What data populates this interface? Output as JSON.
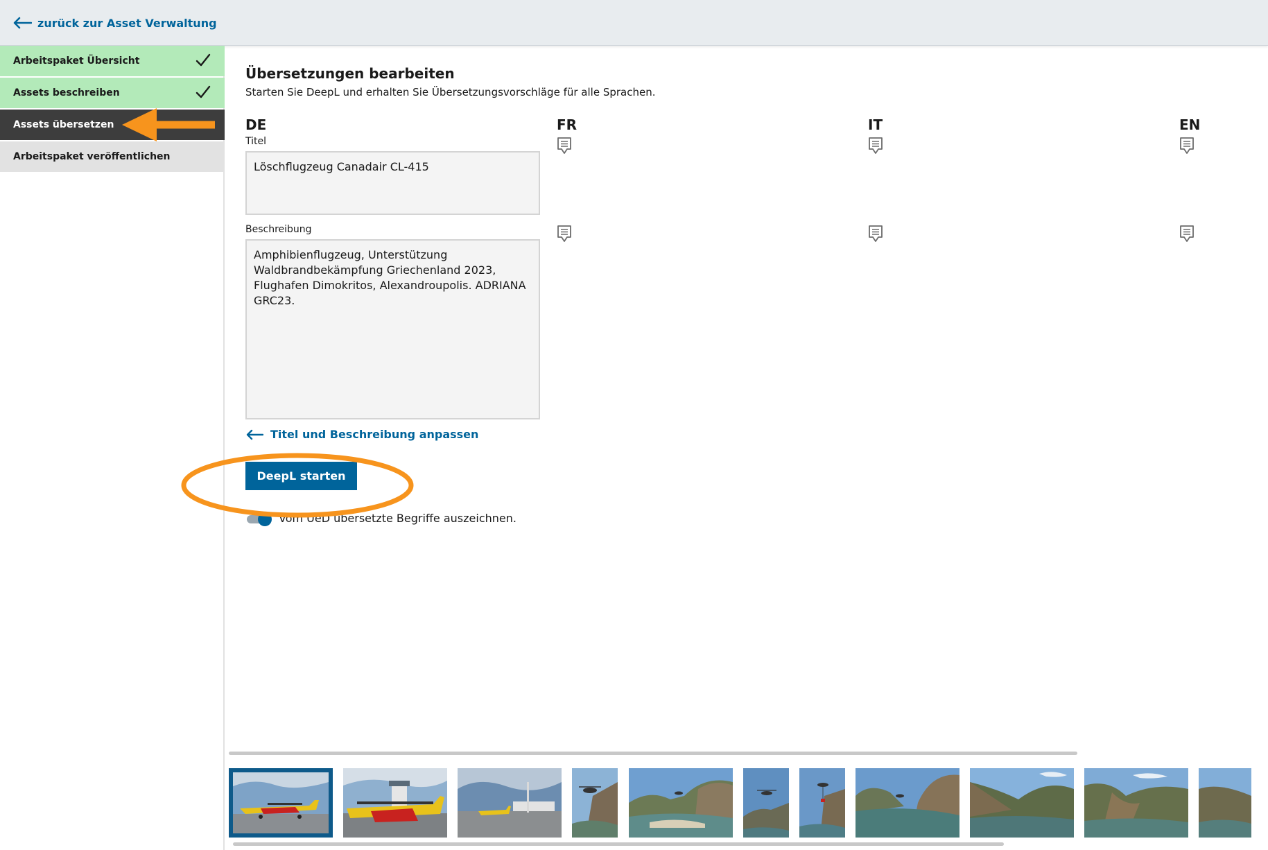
{
  "topbar": {
    "back_label": "zurück zur Asset Verwaltung"
  },
  "sidebar": {
    "items": [
      {
        "label": "Arbeitspaket Übersicht",
        "state": "done"
      },
      {
        "label": "Assets beschreiben",
        "state": "done"
      },
      {
        "label": "Assets übersetzen",
        "state": "active"
      },
      {
        "label": "Arbeitspaket veröffentlichen",
        "state": "todo"
      }
    ]
  },
  "main": {
    "title": "Übersetzungen bearbeiten",
    "subtitle": "Starten Sie DeepL und erhalten Sie Übersetzungsvorschläge für alle Sprachen.",
    "languages": [
      "DE",
      "FR",
      "IT",
      "EN"
    ],
    "title_label": "Titel",
    "title_value": "Löschflugzeug Canadair CL-415",
    "description_label": "Beschreibung",
    "description_value": "Amphibienflugzeug, Unterstützung Waldbrandbekämpfung Griechenland 2023, Flughafen Dimokritos, Alexandroupolis. ADRIANA GRC23.",
    "adjust_link": "Titel und Beschreibung anpassen",
    "deepl_button": "DeepL starten",
    "toggle_label": "Vom UeD übersetzte Begriffe auszeichnen.",
    "toggle_on": true
  },
  "thumbnails": {
    "selected_index": 0,
    "items": [
      {
        "subject": "plane-tarmac-yellow"
      },
      {
        "subject": "plane-tower"
      },
      {
        "subject": "airport-apron"
      },
      {
        "subject": "helicopter-cliff"
      },
      {
        "subject": "river-gorge-helicopter"
      },
      {
        "subject": "helicopter-sky"
      },
      {
        "subject": "helicopter-bucket"
      },
      {
        "subject": "river-gorge"
      },
      {
        "subject": "gorge-hills"
      },
      {
        "subject": "gorge-hills"
      },
      {
        "subject": "gorge-partial"
      }
    ]
  },
  "colors": {
    "accent": "#00649b",
    "done_green": "#b3eab9",
    "active_dark": "#3d3d3d",
    "annotation_orange": "#f7941d"
  }
}
